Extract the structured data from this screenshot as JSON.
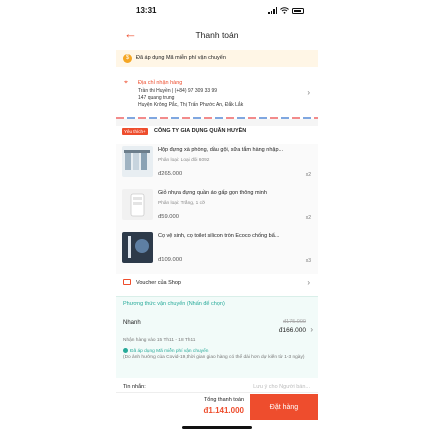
{
  "status_bar": {
    "time": "13:31"
  },
  "header": {
    "back_icon": "arrow-left-icon",
    "title": "Thanh toán"
  },
  "freeship_banner": {
    "text": "Đã áp dụng Mã miễn phí vận chuyển"
  },
  "address": {
    "label": "Địa chỉ nhận hàng",
    "name_phone": "Trần thi Huyền | (+84) 97 309 33 99",
    "street": "147 quang trung",
    "region": "Huyện Krông Pắc, Thị Trấn Phước An, Đắk Lắk"
  },
  "shop": {
    "tag": "Yêu thích+",
    "name": "CÔNG TY GIA DỤNG QUÂN HUYỀN"
  },
  "items": [
    {
      "name": "Hộp đựng xà phòng, dầu gội, sữa tắm hàng nhập...",
      "variant": "Phân loại: Loại đôi 6092",
      "price": "đ265.000",
      "qty": "x2"
    },
    {
      "name": "Giỏ nhựa đựng quần áo gấp gọn thông minh",
      "variant": "Phân loại: Trắng, 1 cỡ",
      "price": "đ59.000",
      "qty": "x2"
    },
    {
      "name": "Cọ vệ sinh, cọ toilet silicon tròn Ecoco chống bẩ...",
      "variant": "",
      "price": "đ109.000",
      "qty": "x3"
    }
  ],
  "voucher": {
    "label": "Voucher của Shop"
  },
  "shipping": {
    "heading": "Phương thức vận chuyển (Nhấn để chọn)",
    "method": "Nhanh",
    "original_fee": "đ175.000",
    "fee": "đ166.000",
    "eta": "Nhận hàng vào 15 Th11 - 18 Th11",
    "applied": "Đã áp dụng Mã miễn phí vận chuyển",
    "note": "(Do ảnh hưởng của Covid-19,thời gian giao hàng có thể dài hơn dự kiến từ 1-3 ngày)"
  },
  "message": {
    "label": "Tin nhắn:",
    "value": "",
    "placeholder": "Lưu ý cho Người bán..."
  },
  "footer": {
    "total_label": "Tổng thanh toán",
    "total": "đ1.141.000",
    "order_button": "Đặt hàng"
  },
  "colors": {
    "accent": "#ee4d2d",
    "teal": "#26aa99",
    "warning": "#f5a623"
  }
}
